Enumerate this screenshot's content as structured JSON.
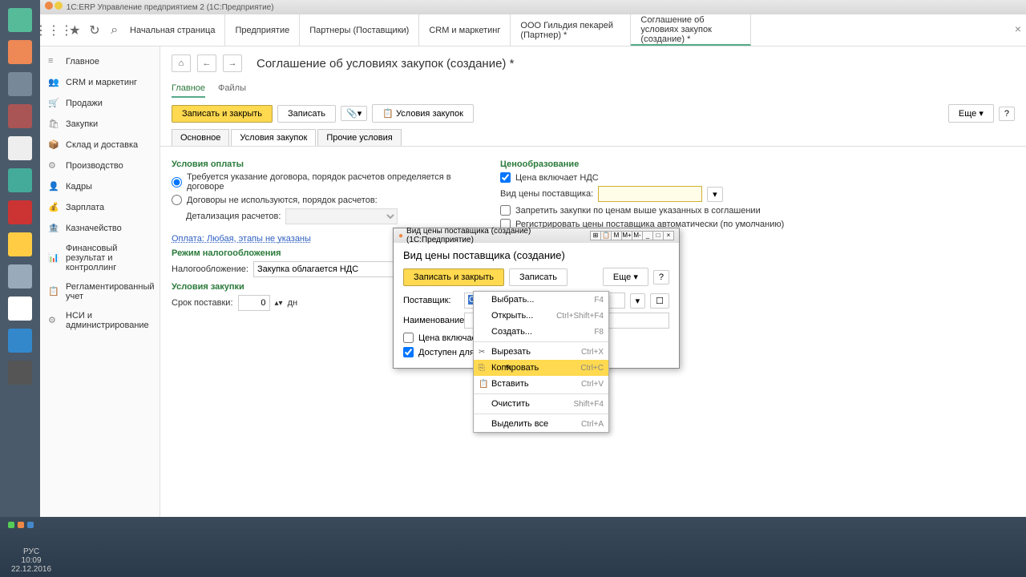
{
  "window_title": "1С:ERP Управление предприятием 2  (1С:Предприятие)",
  "top_tabs": [
    "Начальная страница",
    "Предприятие",
    "Партнеры (Поставщики)",
    "CRM и маркетинг",
    "ООО Гильдия пекарей (Партнер) *",
    "Соглашение об условиях закупок (создание) *"
  ],
  "sidebar": [
    "Главное",
    "CRM и маркетинг",
    "Продажи",
    "Закупки",
    "Склад и доставка",
    "Производство",
    "Кадры",
    "Зарплата",
    "Казначейство",
    "Финансовый результат и контроллинг",
    "Регламентированный учет",
    "НСИ и администрирование"
  ],
  "page_title": "Соглашение об условиях закупок (создание) *",
  "subtabs": {
    "main": "Главное",
    "files": "Файлы"
  },
  "toolbar": {
    "save_close": "Записать и закрыть",
    "save": "Записать",
    "terms": "Условия закупок",
    "more": "Еще"
  },
  "inner_tabs": [
    "Основное",
    "Условия закупок",
    "Прочие условия"
  ],
  "form": {
    "pay_sec": "Условия оплаты",
    "opt1": "Требуется указание договора, порядок расчетов определяется в договоре",
    "opt2": "Договоры не используются, порядок расчетов:",
    "detail": "Детализация расчетов:",
    "pay_link": "Оплата: Любая, этапы не указаны",
    "tax_sec": "Режим налогообложения",
    "tax_lbl": "Налогообложение:",
    "tax_val": "Закупка облагается НДС",
    "buy_sec": "Условия закупки",
    "term_lbl": "Срок поставки:",
    "term_val": "0",
    "term_unit": "дн",
    "price_sec": "Ценообразование",
    "vat": "Цена включает НДС",
    "ptype_lbl": "Вид цены поставщика:",
    "ban": "Запретить закупки по ценам выше указанных в соглашении",
    "reg": "Регистрировать цены поставщика автоматически (по умолчанию)"
  },
  "dialog": {
    "titlebar": "Вид цены поставщика (создание)  (1С:Предприятие)",
    "heading": "Вид цены поставщика (создание)",
    "save_close": "Записать и закрыть",
    "save": "Записать",
    "more": "Еще",
    "supplier_lbl": "Поставщик:",
    "supplier_val": "ООО Гильдия пекарей",
    "name_lbl": "Наименование:",
    "vat": "Цена включает НДС",
    "avail": "Доступен для закупки"
  },
  "ctx": [
    {
      "t": "Выбрать...",
      "s": "F4"
    },
    {
      "t": "Открыть...",
      "s": "Ctrl+Shift+F4"
    },
    {
      "t": "Создать...",
      "s": "F8"
    },
    {
      "sep": true
    },
    {
      "t": "Вырезать",
      "s": "Ctrl+X",
      "i": "✂"
    },
    {
      "t": "Копировать",
      "s": "Ctrl+C",
      "i": "⎘",
      "hl": true
    },
    {
      "t": "Вставить",
      "s": "Ctrl+V",
      "i": "📋"
    },
    {
      "sep": true
    },
    {
      "t": "Очистить",
      "s": "Shift+F4"
    },
    {
      "sep": true
    },
    {
      "t": "Выделить все",
      "s": "Ctrl+A"
    }
  ],
  "clock": {
    "time": "10:09",
    "date": "22.12.2016",
    "lang": "РУС"
  }
}
